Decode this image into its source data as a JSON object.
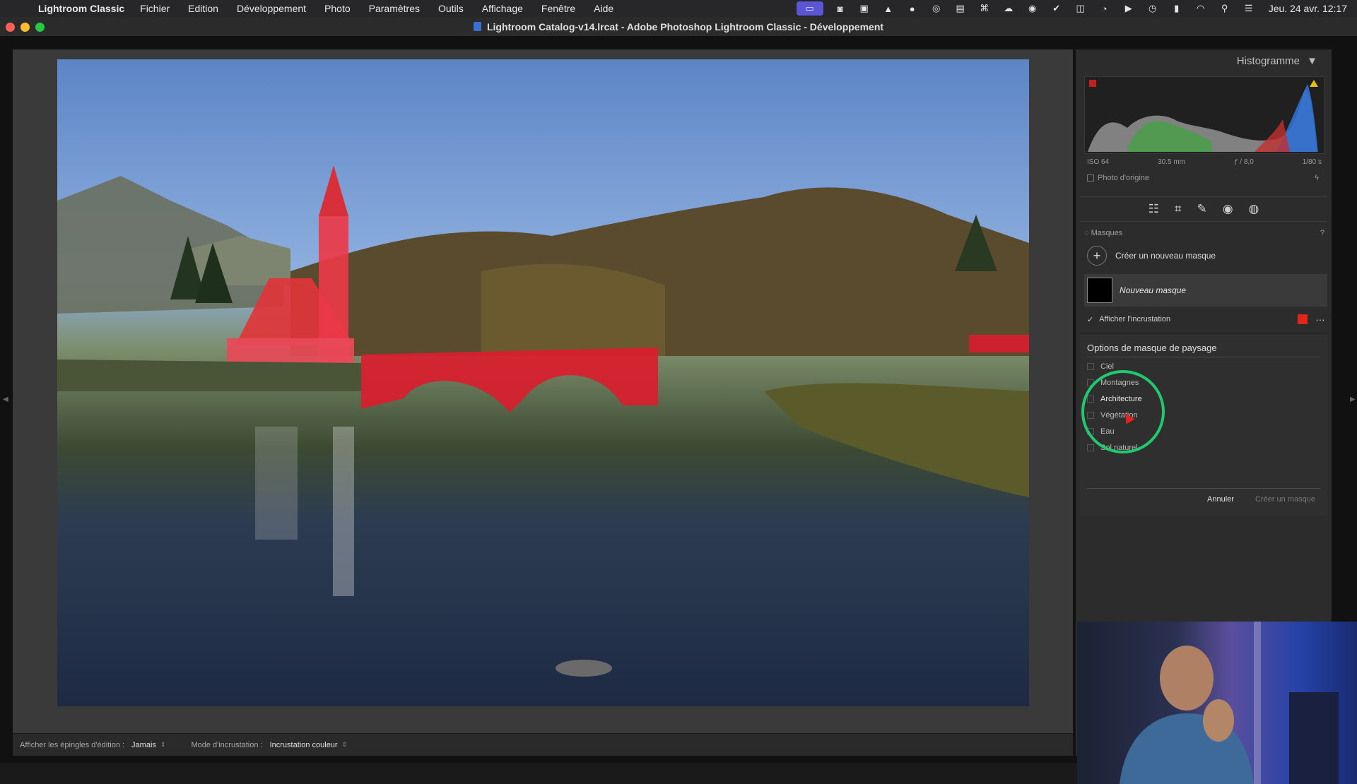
{
  "menubar": {
    "app_name": "Lightroom Classic",
    "items": [
      "Fichier",
      "Edition",
      "Développement",
      "Photo",
      "Paramètres",
      "Outils",
      "Affichage",
      "Fenêtre",
      "Aide"
    ],
    "clock": "Jeu. 24 avr.  12:17"
  },
  "window": {
    "title": "Lightroom Catalog-v14.lrcat - Adobe Photoshop Lightroom Classic - Développement"
  },
  "histogram": {
    "header": "Histogramme",
    "iso": "ISO 64",
    "focal": "30.5 mm",
    "aperture": "ƒ / 8,0",
    "shutter": "1/80 s",
    "original_photo_label": "Photo d'origine"
  },
  "masks": {
    "section_label": "Masques",
    "create_new": "Créer un nouveau masque",
    "mask_name": "Nouveau masque",
    "show_overlay": "Afficher l'incrustation",
    "overlay_color": "#e0251b"
  },
  "landscape": {
    "title": "Options de masque de paysage",
    "options": [
      "Ciel",
      "Montagnes",
      "Architecture",
      "Végétation",
      "Eau",
      "Sol naturel"
    ],
    "cancel": "Annuler",
    "create": "Créer un masque"
  },
  "toolbar": {
    "pins_label": "Afficher les épingles d'édition :",
    "pins_value": "Jamais",
    "overlay_mode_label": "Mode d'incrustation :",
    "overlay_mode_value": "Incrustation couleur"
  },
  "colors": {
    "highlight_ring": "#22c86e",
    "mask_overlay": "#e0251b"
  }
}
